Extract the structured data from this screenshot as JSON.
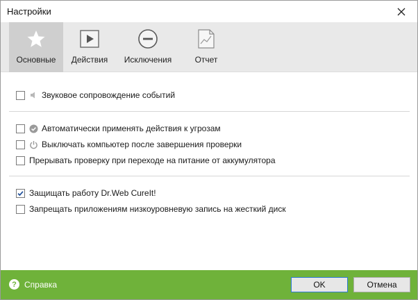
{
  "window": {
    "title": "Настройки"
  },
  "tabs": [
    {
      "label": "Основные",
      "icon": "star-icon",
      "active": true
    },
    {
      "label": "Действия",
      "icon": "play-icon",
      "active": false
    },
    {
      "label": "Исключения",
      "icon": "minus-circle-icon",
      "active": false
    },
    {
      "label": "Отчет",
      "icon": "report-icon",
      "active": false
    }
  ],
  "options": [
    {
      "label": "Звуковое сопровождение событий",
      "checked": false,
      "icon": "speaker-icon"
    },
    {
      "label": "Автоматически применять действия к угрозам",
      "checked": false,
      "icon": "check-circle-icon"
    },
    {
      "label": "Выключать компьютер после завершения проверки",
      "checked": false,
      "icon": "power-icon"
    },
    {
      "label": "Прерывать проверку при переходе на питание от аккумулятора",
      "checked": false,
      "icon": ""
    },
    {
      "label": "Защищать работу Dr.Web CureIt!",
      "checked": true,
      "icon": ""
    },
    {
      "label": "Запрещать приложениям низкоуровневую запись на жесткий диск",
      "checked": false,
      "icon": ""
    }
  ],
  "footer": {
    "help_label": "Справка",
    "help_icon_glyph": "?",
    "ok_label": "OK",
    "cancel_label": "Отмена"
  },
  "colors": {
    "footer": "#6fb23a",
    "active_tab": "#cfcfcf",
    "toolbar": "#e9e9e9"
  }
}
